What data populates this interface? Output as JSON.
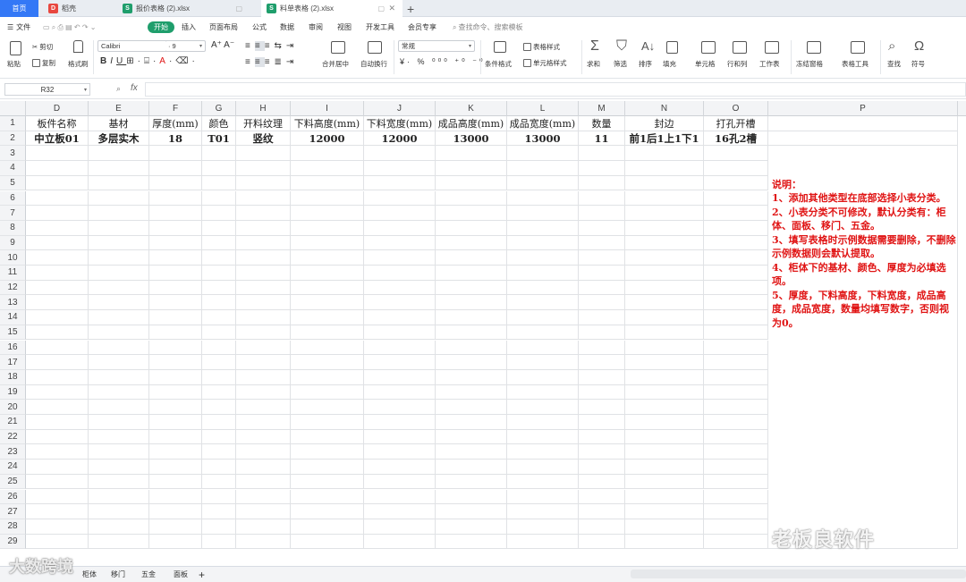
{
  "tabs": [
    {
      "label": "首页",
      "type": "home"
    },
    {
      "label": "稻壳",
      "icon": "D",
      "color": "#e8473f"
    },
    {
      "label": "报价表格 (2).xlsx",
      "icon": "S",
      "color": "#1f9e6c"
    },
    {
      "label": "料单表格 (2).xlsx",
      "icon": "S",
      "color": "#1f9e6c",
      "active": true
    }
  ],
  "tab_add": "+",
  "menu": {
    "file": "文件",
    "items": [
      "开始",
      "插入",
      "页面布局",
      "公式",
      "数据",
      "审阅",
      "视图",
      "开发工具",
      "会员专享"
    ],
    "search": "查找命令、搜索模板"
  },
  "ribbon": {
    "paste": "粘贴",
    "cut": "剪切",
    "copy": "复制",
    "format_painter": "格式刷",
    "font_name": "Calibri",
    "font_size": "9",
    "merge": "合并居中",
    "wrap": "自动换行",
    "number_format": "常规",
    "conditional": "条件格式",
    "table_style": "表格样式",
    "cell_style": "单元格样式",
    "sum": "求和",
    "filter": "筛选",
    "sort": "排序",
    "fill": "填充",
    "cell": "单元格",
    "rowcol": "行和列",
    "worksheet": "工作表",
    "freeze": "冻结窗格",
    "table_tools": "表格工具",
    "find": "查找",
    "symbol": "符号"
  },
  "namebox": "R32",
  "fx": "fx",
  "columns": [
    "D",
    "E",
    "F",
    "G",
    "H",
    "I",
    "J",
    "K",
    "L",
    "M",
    "N",
    "O",
    "P"
  ],
  "rows": [
    "1",
    "2",
    "3",
    "4",
    "5",
    "6",
    "7",
    "8",
    "9",
    "10",
    "11",
    "12",
    "13",
    "14",
    "15",
    "16",
    "17",
    "18",
    "19",
    "20",
    "21",
    "22",
    "23",
    "24",
    "25",
    "26",
    "27",
    "28",
    "29"
  ],
  "header_row": [
    "板件名称",
    "基材",
    "厚度(mm)",
    "颜色",
    "开料纹理",
    "下料高度(mm)",
    "下料宽度(mm)",
    "成品高度(mm)",
    "成品宽度(mm)",
    "数量",
    "封边",
    "打孔开槽",
    ""
  ],
  "data_row": [
    "中立板01",
    "多层实木",
    "18",
    "T01",
    "竖纹",
    "12000",
    "12000",
    "13000",
    "13000",
    "11",
    "前1后1上1下1",
    "16孔2槽",
    ""
  ],
  "note": "说明：\n1、添加其他类型在底部选择小表分类。\n2、小表分类不可修改，默认分类有：柜体、面板、移门、五金。\n3、填写表格时示例数据需要删除，不删除示例数据则会默认提取。\n4、柜体下的基材、颜色、厚度为必填选项。\n5、厚度，下料高度，下料宽度，成品高度，成品宽度，数量均填写数字，否则视为0。",
  "sheets": [
    "柜体",
    "移门",
    "五金",
    "面板"
  ],
  "sheet_add": "+",
  "watermark_left": "大数跨境",
  "watermark_right": "老板良软件"
}
